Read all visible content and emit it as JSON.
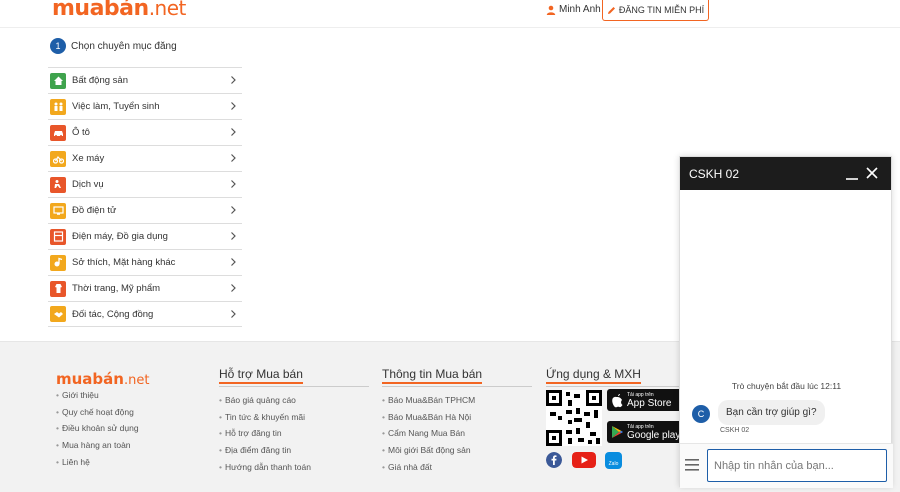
{
  "header": {
    "logo_main": "muabán",
    "logo_tld": ".net",
    "user_name": "Minh Anh",
    "post_button": "ĐĂNG TIN MIỄN PHÍ"
  },
  "step": {
    "number": "1",
    "label": "Chọn chuyên mục đăng"
  },
  "categories": [
    {
      "label": "Bất động sản",
      "icon": "house-icon",
      "color": "#3fa34d"
    },
    {
      "label": "Việc làm, Tuyển sinh",
      "icon": "people-icon",
      "color": "#f2a81d"
    },
    {
      "label": "Ô tô",
      "icon": "car-icon",
      "color": "#e8562a"
    },
    {
      "label": "Xe máy",
      "icon": "motorbike-icon",
      "color": "#f2a81d"
    },
    {
      "label": "Dịch vụ",
      "icon": "service-icon",
      "color": "#e8562a"
    },
    {
      "label": "Đồ điện tử",
      "icon": "electronics-icon",
      "color": "#f2a81d"
    },
    {
      "label": "Điện máy, Đồ gia dụng",
      "icon": "appliance-icon",
      "color": "#e8562a"
    },
    {
      "label": "Sở thích, Mặt hàng khác",
      "icon": "hobby-icon",
      "color": "#f2a81d"
    },
    {
      "label": "Thời trang, Mỹ phẩm",
      "icon": "fashion-icon",
      "color": "#e8562a"
    },
    {
      "label": "Đối tác, Cộng đồng",
      "icon": "handshake-icon",
      "color": "#f2a81d"
    }
  ],
  "footer": {
    "logo_main": "muabán",
    "logo_tld": ".net",
    "col1_links": [
      "Giới thiệu",
      "Quy chế hoạt động",
      "Điều khoản sử dụng",
      "Mua hàng an toàn",
      "Liên hệ"
    ],
    "col2_title": "Hỗ trợ Mua bán",
    "col2_links": [
      "Báo giá quảng cáo",
      "Tin tức & khuyến mãi",
      "Hỗ trợ đăng tin",
      "Địa điểm đăng tin",
      "Hướng dẫn thanh toán"
    ],
    "col3_title": "Thông tin Mua bán",
    "col3_links": [
      "Báo Mua&Bán TPHCM",
      "Báo Mua&Bán Hà Nội",
      "Cẩm Nang Mua Bán",
      "Môi giới Bất động sản",
      "Giá nhà đất"
    ],
    "col4_title": "Ứng dụng & MXH",
    "appstore_small": "Tải app trên",
    "appstore_big": "App Store",
    "googleplay_small": "Tải app trên",
    "googleplay_big": "Google play",
    "zalo_label": "Zalo"
  },
  "chat": {
    "title": "CSKH 02",
    "start_text": "Trò chuyện bắt đầu lúc 12:11",
    "agent_initial": "C",
    "message": "Bạn cần trợ giúp gì?",
    "agent_name": "CSKH 02",
    "input_placeholder": "Nhập tin nhắn của bạn..."
  },
  "colors": {
    "brand_orange": "#f26522",
    "accent_blue": "#1e5ea8",
    "chat_header": "#1c1c1c"
  }
}
